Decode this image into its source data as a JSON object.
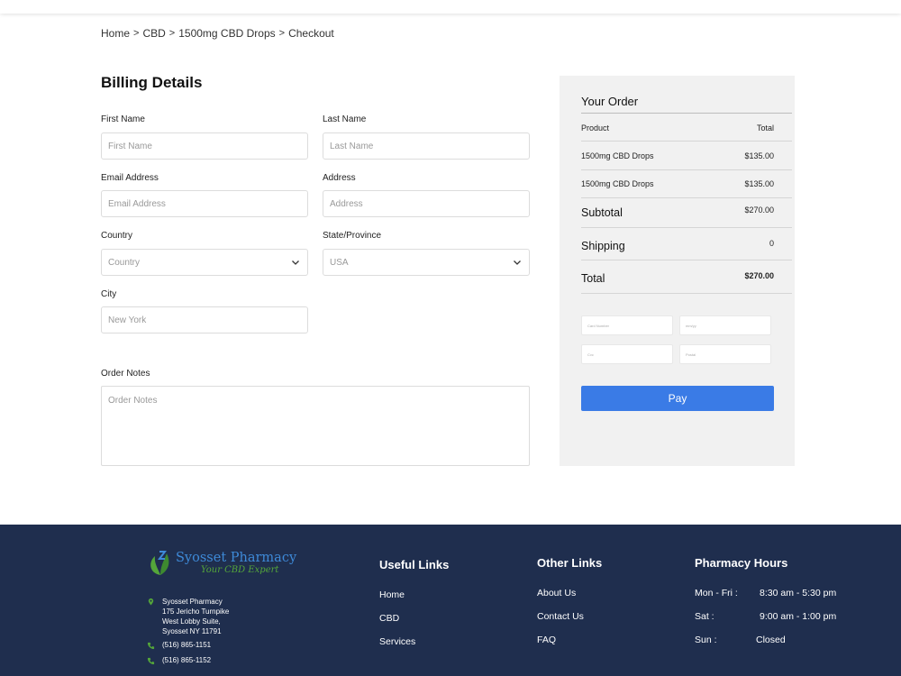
{
  "breadcrumb": {
    "items": [
      "Home",
      "CBD",
      "1500mg CBD Drops",
      "Checkout"
    ],
    "separator": ">"
  },
  "billing": {
    "title": "Billing Details",
    "first_name": {
      "label": "First Name",
      "placeholder": "First Name"
    },
    "last_name": {
      "label": "Last Name",
      "placeholder": "Last Name"
    },
    "email": {
      "label": "Email Address",
      "placeholder": "Email Address"
    },
    "address": {
      "label": "Address",
      "placeholder": "Address"
    },
    "country": {
      "label": "Country",
      "value": "Country"
    },
    "state": {
      "label": "State/Province",
      "value": "USA"
    },
    "city": {
      "label": "City",
      "placeholder": "New York"
    },
    "notes": {
      "label": "Order Notes",
      "placeholder": "Order Notes"
    }
  },
  "order": {
    "title": "Your Order",
    "header": {
      "product": "Product",
      "total": "Total"
    },
    "items": [
      {
        "name": "1500mg CBD Drops",
        "price": "$135.00"
      },
      {
        "name": "1500mg CBD Drops",
        "price": "$135.00"
      }
    ],
    "subtotal": {
      "label": "Subtotal",
      "value": "$270.00"
    },
    "shipping": {
      "label": "Shipping",
      "value": "0"
    },
    "total": {
      "label": "Total",
      "value": "$270.00"
    },
    "payment": {
      "card_number": "Card Number",
      "expiry": "mm/yy",
      "cvc": "Cvc",
      "postal": "Postal"
    },
    "pay_label": "Pay"
  },
  "footer": {
    "logo": {
      "name": "Syosset Pharmacy",
      "tagline": "Your CBD Expert"
    },
    "address": [
      "Syosset Pharmacy",
      "175 Jericho Turnpike",
      "West Lobby Suite,",
      "Syosset NY 11791"
    ],
    "phone1": "(516) 865-1151",
    "phone2": "(516) 865-1152",
    "useful_links": {
      "heading": "Useful Links",
      "items": [
        "Home",
        "CBD",
        "Services"
      ]
    },
    "other_links": {
      "heading": "Other Links",
      "items": [
        "About Us",
        "Contact Us",
        "FAQ"
      ]
    },
    "hours": {
      "heading": "Pharmacy Hours",
      "rows": [
        {
          "day": "Mon - Fri :",
          "time": "8:30 am - 5:30 pm"
        },
        {
          "day": "Sat :",
          "time": "9:00 am - 1:00 pm"
        },
        {
          "day": "Sun :",
          "time": "Closed"
        }
      ]
    }
  },
  "colors": {
    "accent": "#3a7be6",
    "footer_bg": "#1f2e4e",
    "panel_bg": "#f1f1f1",
    "logo_blue": "#3e8ad8",
    "logo_green": "#54a63a"
  }
}
